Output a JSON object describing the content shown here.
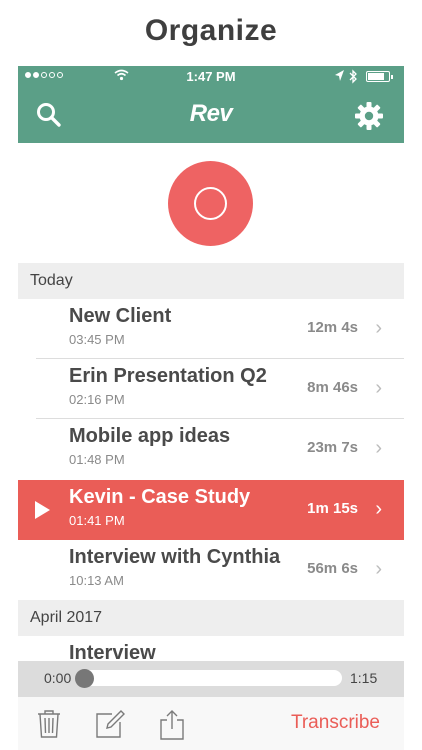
{
  "headline": "Organize",
  "status_bar": {
    "time": "1:47 PM"
  },
  "nav": {
    "logo": "Rev",
    "icons": [
      "search-icon",
      "gear-icon"
    ]
  },
  "colors": {
    "nav_bg": "#5b9f87",
    "record": "#ee6363",
    "active_row": "#ea5d57",
    "transcribe": "#ea5d57"
  },
  "sections": [
    {
      "label": "Today",
      "items": [
        {
          "title": "New Client",
          "time": "03:45 PM",
          "duration": "12m 4s",
          "active": false
        },
        {
          "title": "Erin Presentation Q2",
          "time": "02:16 PM",
          "duration": "8m 46s",
          "active": false
        },
        {
          "title": "Mobile app ideas",
          "time": "01:48 PM",
          "duration": "23m 7s",
          "active": false
        },
        {
          "title": "Kevin - Case Study",
          "time": "01:41 PM",
          "duration": "1m 15s",
          "active": true
        },
        {
          "title": "Interview with Cynthia",
          "time": "10:13 AM",
          "duration": "56m 6s",
          "active": false
        }
      ]
    },
    {
      "label": "April 2017",
      "items": [
        {
          "title": "Interview",
          "time": "",
          "duration": "",
          "active": false
        }
      ]
    }
  ],
  "player": {
    "current": "0:00",
    "total": "1:15",
    "progress": 0
  },
  "toolbar": {
    "transcribe_label": "Transcribe",
    "icons": [
      "trash-icon",
      "edit-icon",
      "share-icon"
    ]
  }
}
